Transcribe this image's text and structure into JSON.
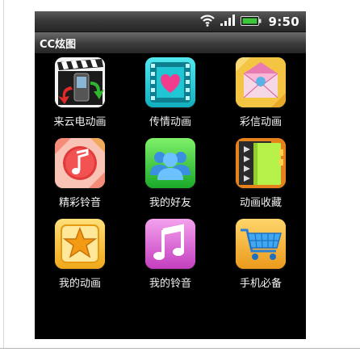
{
  "status_bar": {
    "time": "9:50",
    "icons": [
      "wifi-icon",
      "signal-icon",
      "battery-icon"
    ],
    "battery_color": "#3ec63a"
  },
  "app": {
    "title": "CC炫图"
  },
  "grid": {
    "items": [
      {
        "label": "来云电动画",
        "icon": "clapperboard-phone-icon"
      },
      {
        "label": "传情动画",
        "icon": "heart-film-icon"
      },
      {
        "label": "彩信动画",
        "icon": "envelope-icon"
      },
      {
        "label": "精彩铃音",
        "icon": "music-note-icon"
      },
      {
        "label": "我的好友",
        "icon": "friends-icon"
      },
      {
        "label": "动画收藏",
        "icon": "folder-icon"
      },
      {
        "label": "我的动画",
        "icon": "star-icon"
      },
      {
        "label": "我的铃音",
        "icon": "music-note-pink-icon"
      },
      {
        "label": "手机必备",
        "icon": "shopping-cart-icon"
      }
    ]
  }
}
